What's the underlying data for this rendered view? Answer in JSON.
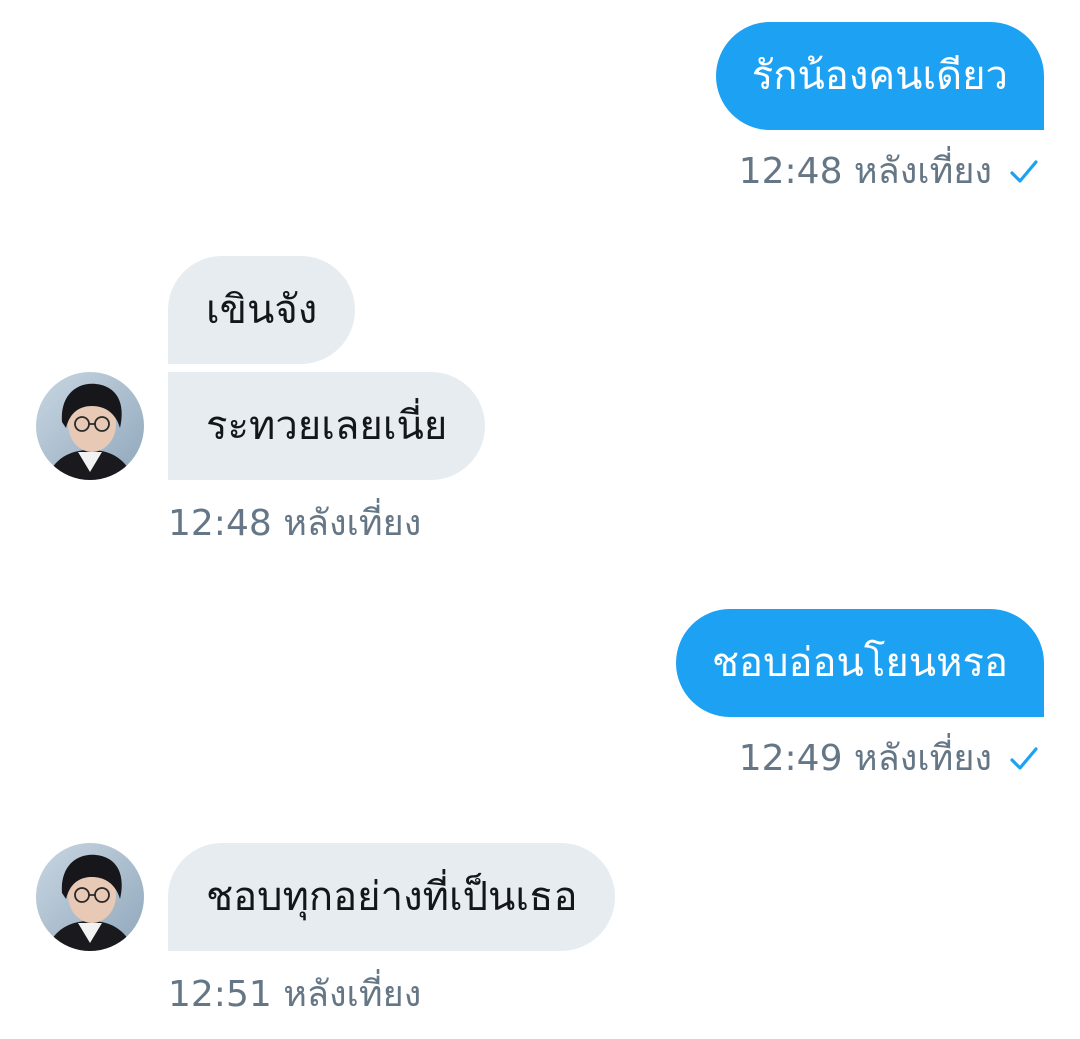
{
  "colors": {
    "sent_bubble": "#1da1f2",
    "received_bubble": "#e6ecf0",
    "timestamp": "#657786",
    "check": "#1da1f2"
  },
  "messages": [
    {
      "side": "sent",
      "text": "รักน้องคนเดียว",
      "time": "12:48 หลังเที่ยง",
      "status_icon": "check-icon"
    },
    {
      "side": "received",
      "texts": [
        "เขินจัง",
        "ระทวยเลยเนี่ย"
      ],
      "time": "12:48 หลังเที่ยง",
      "avatar_icon": "avatar"
    },
    {
      "side": "sent",
      "text": "ชอบอ่อนโยนหรอ",
      "time": "12:49 หลังเที่ยง",
      "status_icon": "check-icon"
    },
    {
      "side": "received",
      "texts": [
        "ชอบทุกอย่างที่เป็นเธอ"
      ],
      "time": "12:51 หลังเที่ยง",
      "avatar_icon": "avatar"
    }
  ]
}
